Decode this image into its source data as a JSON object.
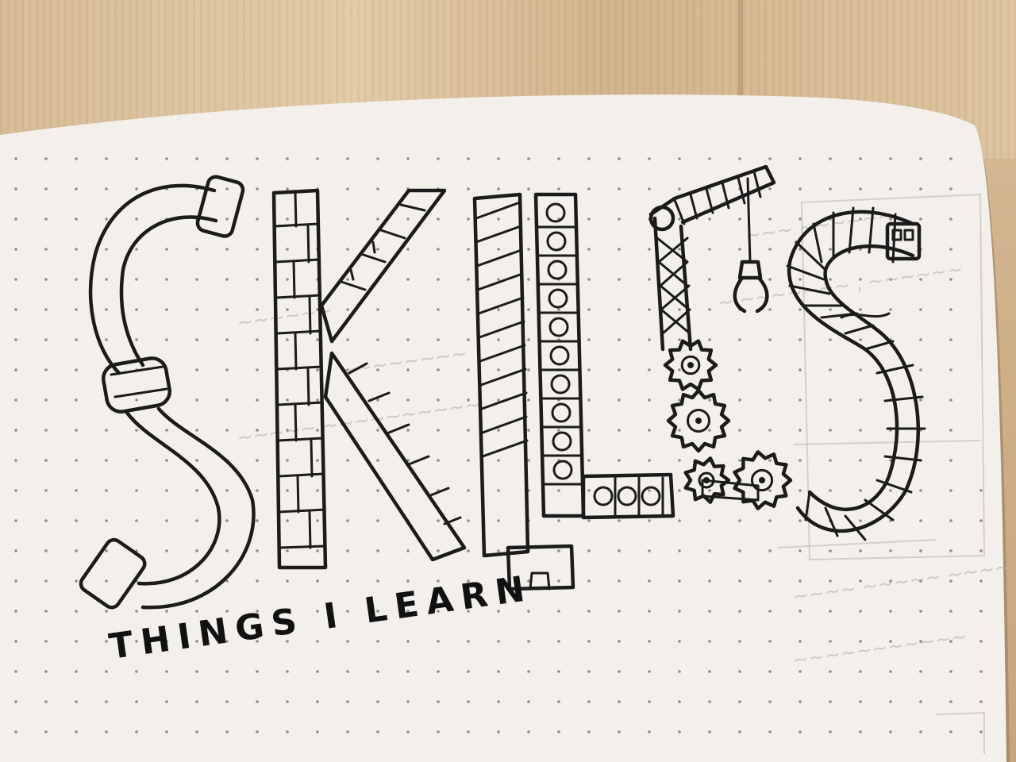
{
  "headline": {
    "title": "SKILLS",
    "subtitle": "THINGS I LEARN"
  },
  "colors": {
    "ink": "#1b1b1b",
    "paper": "#f3f0ec",
    "table_wood": "#d6bb95",
    "dot_grid": "#8f8c88"
  },
  "letters": [
    {
      "char": "S",
      "motif": "pipe"
    },
    {
      "char": "K",
      "motif": "brick"
    },
    {
      "char": "I",
      "motif": "striped-post"
    },
    {
      "char": "L",
      "motif": "punched-strip"
    },
    {
      "char": "L",
      "motif": "crane-and-gears"
    },
    {
      "char": "S",
      "motif": "railway-track"
    }
  ]
}
